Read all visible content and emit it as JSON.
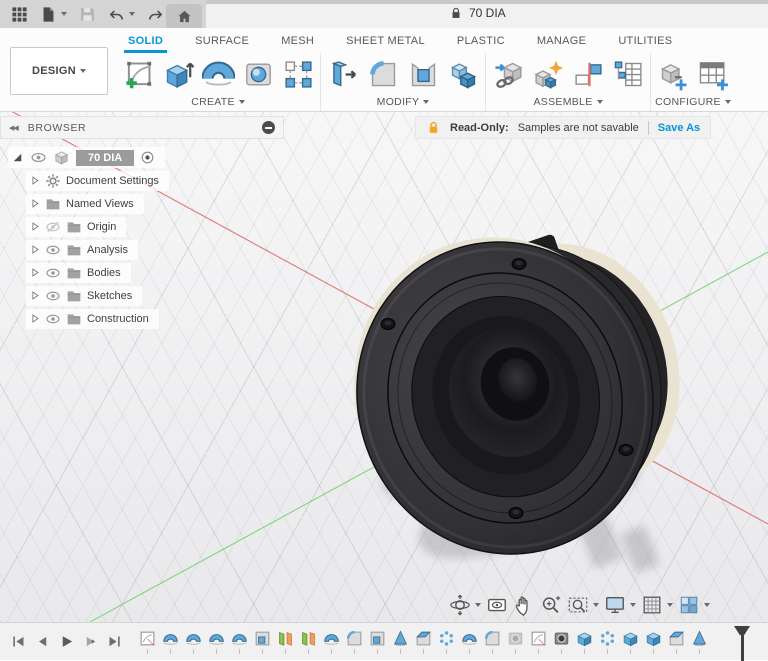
{
  "colors": {
    "accent": "#0696d7",
    "readonly_lock": "#f5a623",
    "axis_x": "#e06060",
    "axis_y": "#6ed06e"
  },
  "titlebar": {
    "document_title": "70 DIA",
    "buttons": [
      {
        "name": "app-launcher",
        "icon": "#i-appgrid",
        "caret": false
      },
      {
        "name": "file-menu",
        "icon": "#i-file",
        "caret": true
      },
      {
        "name": "save",
        "icon": "#i-save",
        "caret": false
      },
      {
        "name": "undo",
        "icon": "#i-undo",
        "caret": true
      },
      {
        "name": "redo",
        "icon": "#i-redo",
        "caret": true
      }
    ]
  },
  "tabs": [
    {
      "label": "SOLID",
      "cls": "active"
    },
    {
      "label": "SURFACE",
      "cls": ""
    },
    {
      "label": "MESH",
      "cls": ""
    },
    {
      "label": "SHEET METAL",
      "cls": ""
    },
    {
      "label": "PLASTIC",
      "cls": ""
    },
    {
      "label": "MANAGE",
      "cls": ""
    },
    {
      "label": "UTILITIES",
      "cls": ""
    }
  ],
  "design_menu": {
    "label": "DESIGN"
  },
  "ribbon_groups": [
    {
      "label": "CREATE",
      "items": [
        {
          "name": "create-sketch",
          "icon": "#i-sketch"
        },
        {
          "name": "extrude",
          "icon": "#i-extrude"
        },
        {
          "name": "revolve",
          "icon": "#i-revolve"
        },
        {
          "name": "hole",
          "icon": "#i-hole"
        },
        {
          "name": "rectangular-pattern",
          "icon": "#i-pattern"
        }
      ]
    },
    {
      "label": "MODIFY",
      "items": [
        {
          "name": "press-pull",
          "icon": "#i-presspull"
        },
        {
          "name": "fillet",
          "icon": "#i-fillet"
        },
        {
          "name": "shell",
          "icon": "#i-shell"
        },
        {
          "name": "combine",
          "icon": "#i-combine"
        }
      ]
    },
    {
      "label": "ASSEMBLE",
      "items": [
        {
          "name": "insert-derive",
          "icon": "#i-insert"
        },
        {
          "name": "new-component",
          "icon": "#i-newcomp"
        },
        {
          "name": "joint",
          "icon": "#i-joint"
        },
        {
          "name": "bom-table",
          "icon": "#i-bom"
        }
      ]
    },
    {
      "label": "CONFIGURE",
      "items": [
        {
          "name": "configure",
          "icon": "#i-configa"
        },
        {
          "name": "configuration-table",
          "icon": "#i-configb"
        }
      ]
    }
  ],
  "browser": {
    "title": "BROWSER",
    "root_label": "70 DIA",
    "items": [
      {
        "label": "Document Settings",
        "icon": "#i-gear",
        "eye": null
      },
      {
        "label": "Named Views",
        "icon": "#i-folder",
        "eye": null
      },
      {
        "label": "Origin",
        "icon": "#i-folder",
        "eye": "#i-eyeoff"
      },
      {
        "label": "Analysis",
        "icon": "#i-folder",
        "eye": "#i-eye"
      },
      {
        "label": "Bodies",
        "icon": "#i-folder",
        "eye": "#i-eye"
      },
      {
        "label": "Sketches",
        "icon": "#i-folder",
        "eye": "#i-eye"
      },
      {
        "label": "Construction",
        "icon": "#i-folder",
        "eye": "#i-eye"
      }
    ]
  },
  "banner": {
    "label": "Read-Only:",
    "message": "Samples are not savable",
    "action": "Save As"
  },
  "navbar": [
    {
      "name": "orbit",
      "icon": "#n-orbit",
      "caret": true
    },
    {
      "name": "look-at",
      "icon": "#n-lookat",
      "caret": false
    },
    {
      "name": "pan",
      "icon": "#n-pan",
      "caret": false
    },
    {
      "name": "zoom",
      "icon": "#n-zoom",
      "caret": false
    },
    {
      "name": "fit",
      "icon": "#n-fit",
      "caret": true
    },
    {
      "name": "display-settings",
      "icon": "#n-display",
      "caret": true
    },
    {
      "name": "grid-settings",
      "icon": "#n-grid",
      "caret": true
    },
    {
      "name": "viewports",
      "icon": "#n-viewports",
      "caret": true
    }
  ],
  "timeline": {
    "playback": [
      {
        "name": "go-to-start",
        "icon": "#p-start"
      },
      {
        "name": "step-back",
        "icon": "#p-back"
      },
      {
        "name": "play",
        "icon": "#p-play"
      },
      {
        "name": "step-forward",
        "icon": "#p-fwd"
      },
      {
        "name": "go-to-end",
        "icon": "#p-end"
      }
    ],
    "features": [
      {
        "name": "sketch",
        "icon": "#t-sketch",
        "cls": ""
      },
      {
        "name": "revolve",
        "icon": "#t-revolve",
        "cls": ""
      },
      {
        "name": "revolve",
        "icon": "#t-revolve",
        "cls": ""
      },
      {
        "name": "revolve",
        "icon": "#t-revolve",
        "cls": ""
      },
      {
        "name": "revolve",
        "icon": "#t-revolve",
        "cls": ""
      },
      {
        "name": "shell",
        "icon": "#t-shell",
        "cls": ""
      },
      {
        "name": "mirror",
        "icon": "#t-mirror",
        "cls": ""
      },
      {
        "name": "mirror",
        "icon": "#t-mirror",
        "cls": ""
      },
      {
        "name": "revolve",
        "icon": "#t-revolve",
        "cls": ""
      },
      {
        "name": "fillet",
        "icon": "#t-fillet",
        "cls": ""
      },
      {
        "name": "shell",
        "icon": "#t-shell",
        "cls": ""
      },
      {
        "name": "revolve-cone",
        "icon": "#t-cone",
        "cls": ""
      },
      {
        "name": "chamfer",
        "icon": "#t-chamfer",
        "cls": ""
      },
      {
        "name": "circular-pattern",
        "icon": "#t-dots",
        "cls": ""
      },
      {
        "name": "revolve",
        "icon": "#t-revolve",
        "cls": ""
      },
      {
        "name": "fillet",
        "icon": "#t-fillet",
        "cls": ""
      },
      {
        "name": "hole",
        "icon": "#t-hole",
        "cls": "suppressed"
      },
      {
        "name": "sketch",
        "icon": "#t-sketch",
        "cls": ""
      },
      {
        "name": "hole",
        "icon": "#t-hole",
        "cls": ""
      },
      {
        "name": "extrude",
        "icon": "#t-extrude",
        "cls": ""
      },
      {
        "name": "circular-pattern",
        "icon": "#t-dots",
        "cls": ""
      },
      {
        "name": "extrude",
        "icon": "#t-extrude",
        "cls": ""
      },
      {
        "name": "extrude",
        "icon": "#t-extrude",
        "cls": ""
      },
      {
        "name": "chamfer",
        "icon": "#t-chamfer",
        "cls": ""
      },
      {
        "name": "revolve-cone",
        "icon": "#t-cone",
        "cls": ""
      }
    ]
  }
}
